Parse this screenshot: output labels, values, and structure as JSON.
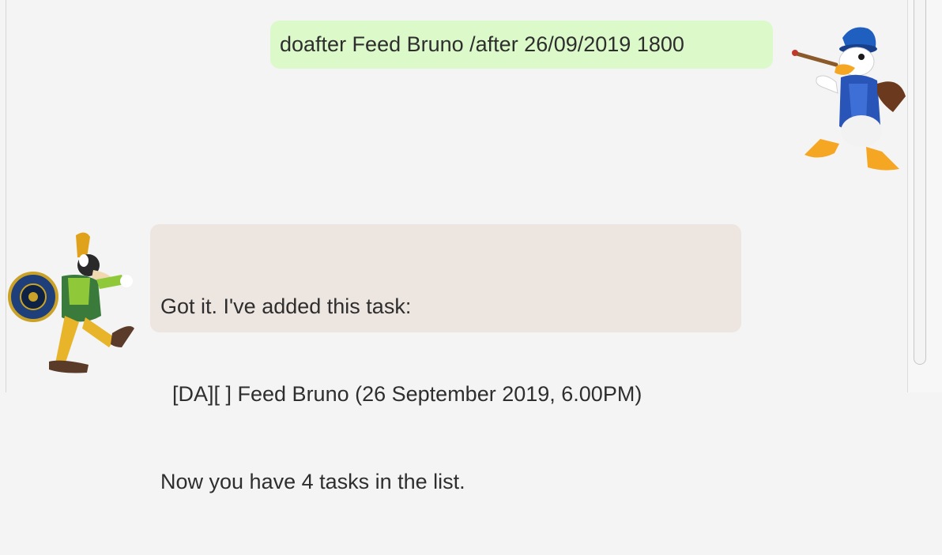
{
  "conversation": {
    "user_message": "doafter Feed Bruno /after 26/09/2019 1800",
    "bot_message": {
      "lines": [
        "Got it. I've added this task:",
        "  [DA][ ] Feed Bruno (26 September 2019, 6.00PM)",
        "Now you have 4 tasks in the list."
      ]
    }
  },
  "avatars": {
    "user": "donald-duck-avatar",
    "bot": "goofy-avatar"
  },
  "colors": {
    "background": "#f4f4f4",
    "user_bubble": "#dcf9c9",
    "bot_bubble": "#ece5e0",
    "text": "#2e2e2e"
  }
}
